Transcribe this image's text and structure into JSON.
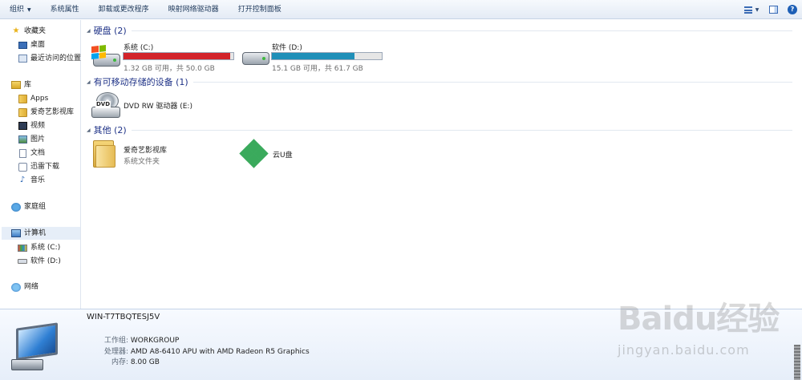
{
  "toolbar": {
    "organize": "组织",
    "system_properties": "系统属性",
    "uninstall": "卸载或更改程序",
    "map_drive": "映射网络驱动器",
    "control_panel": "打开控制面板",
    "right_icons": [
      "view-options-icon",
      "preview-pane-icon",
      "help-icon"
    ]
  },
  "sidebar": {
    "favorites": {
      "label": "收藏夹",
      "items": [
        "桌面",
        "最近访问的位置"
      ]
    },
    "libraries": {
      "label": "库",
      "items": [
        "Apps",
        "爱奇艺影视库",
        "视频",
        "图片",
        "文档",
        "迅雷下载",
        "音乐"
      ]
    },
    "homegroup": "家庭组",
    "computer": {
      "label": "计算机",
      "items": [
        "系统 (C:)",
        "软件 (D:)"
      ]
    },
    "network": "网络"
  },
  "groups": {
    "hdd": {
      "title": "硬盘 (2)",
      "drives": [
        {
          "name": "系统 (C:)",
          "free": "1.32 GB 可用，共 50.0 GB",
          "used_fraction": 0.974,
          "bar_color": "#d2232a"
        },
        {
          "name": "软件 (D:)",
          "free": "15.1 GB 可用，共 61.7 GB",
          "used_fraction": 0.755,
          "bar_color": "#1f8fb8"
        }
      ]
    },
    "removable": {
      "title": "有可移动存储的设备 (1)",
      "devices": [
        {
          "name": "DVD RW 驱动器 (E:)",
          "icon_label": "DVD"
        }
      ]
    },
    "other": {
      "title": "其他 (2)",
      "items": [
        {
          "name": "爱奇艺影视库",
          "sub": "系统文件夹"
        },
        {
          "name": "云U盘"
        }
      ]
    }
  },
  "details": {
    "pc_name": "WIN-T7TBQTESJ5V",
    "rows": [
      {
        "k": "工作组:",
        "v": "WORKGROUP"
      },
      {
        "k": "处理器:",
        "v": "AMD A8-6410 APU with AMD Radeon R5 Graphics"
      },
      {
        "k": "内存:",
        "v": "8.00 GB"
      }
    ]
  },
  "watermark": {
    "logo": "Baidu经验",
    "url": "jingyan.baidu.com"
  }
}
